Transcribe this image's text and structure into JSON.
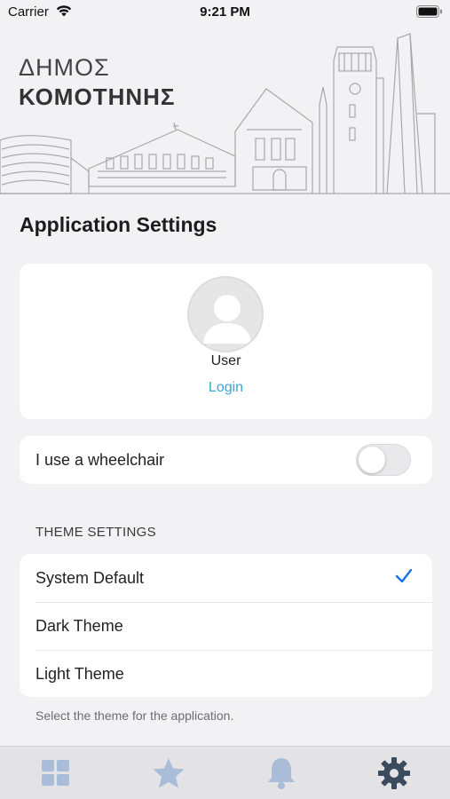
{
  "status_bar": {
    "carrier": "Carrier",
    "time": "9:21 PM"
  },
  "header": {
    "city_line1": "ΔΗΜΟΣ",
    "city_line2": "ΚΟΜΟΤΗΝΗΣ"
  },
  "page_title": "Application Settings",
  "profile": {
    "user_label": "User",
    "login_label": "Login"
  },
  "accessibility": {
    "wheelchair_label": "I use a wheelchair",
    "wheelchair_enabled": false
  },
  "theme": {
    "section_header": "THEME SETTINGS",
    "options": [
      {
        "label": "System Default",
        "selected": true
      },
      {
        "label": "Dark Theme",
        "selected": false
      },
      {
        "label": "Light Theme",
        "selected": false
      }
    ],
    "footer_note": "Select the theme for the application."
  },
  "tab_bar": {
    "tabs": [
      {
        "icon": "grid-icon",
        "active": false
      },
      {
        "icon": "star-icon",
        "active": false
      },
      {
        "icon": "bell-icon",
        "active": false
      },
      {
        "icon": "gear-icon",
        "active": true
      }
    ],
    "colors": {
      "inactive": "#a9bdd8",
      "active": "#3b4a5c"
    }
  },
  "colors": {
    "accent_link": "#3aa6d8",
    "checkmark": "#1a73e8",
    "background": "#f2f2f4"
  }
}
